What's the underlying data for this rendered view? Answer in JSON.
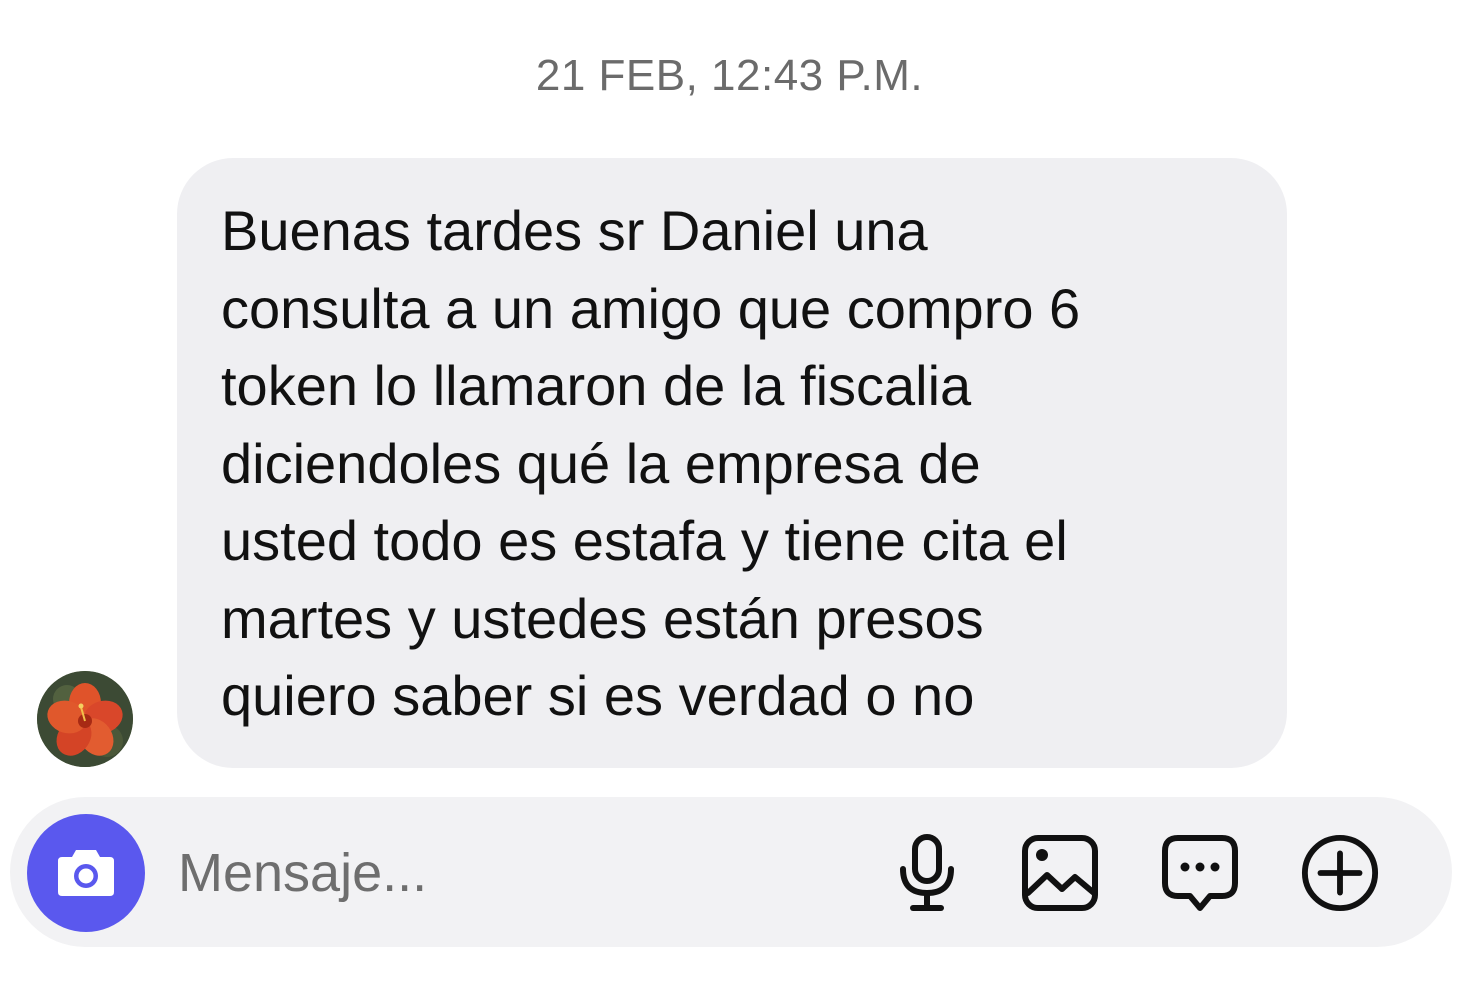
{
  "conversation": {
    "timestamp": "21 FEB, 12:43 P.M.",
    "messages": [
      {
        "direction": "incoming",
        "text": "Buenas tardes sr Daniel una\nconsulta a un amigo que compro 6\ntoken lo llamaron de la fiscalia\ndiciendoles qué la empresa de\nusted todo es estafa y tiene cita el\nmartes  y ustedes están presos\nquiero saber si es verdad o no"
      }
    ]
  },
  "composer": {
    "placeholder": "Mensaje...",
    "value": "",
    "icons": [
      "camera-icon",
      "microphone-icon",
      "image-gallery-icon",
      "sticker-chat-icon",
      "plus-circle-icon"
    ],
    "camera_button_color": "#5a58ee"
  },
  "colors": {
    "incoming_bubble": "#efeff2",
    "composer_background": "#f2f2f4",
    "timestamp_text": "#6b6b6b",
    "message_text": "#111111"
  }
}
